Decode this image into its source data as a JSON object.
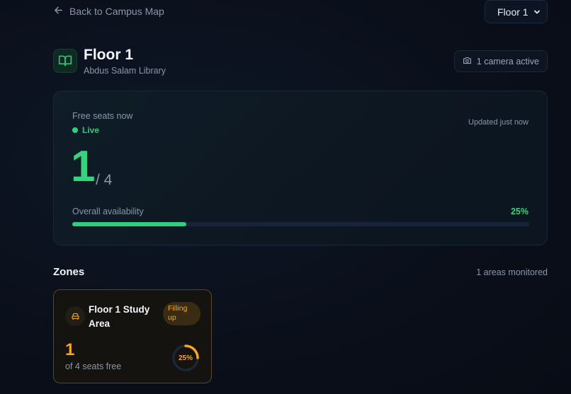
{
  "nav": {
    "back_label": "Back to Campus Map",
    "floor_select_value": "Floor 1"
  },
  "header": {
    "title": "Floor 1",
    "building": "Abdus Salam Library",
    "camera_status": "1 camera active"
  },
  "summary": {
    "free_label": "Free seats now",
    "live_label": "Live",
    "updated_label": "Updated just now",
    "free_seats": "1",
    "total_seats": "/ 4",
    "availability_label": "Overall availability",
    "availability_pct_label": "25%",
    "availability_value": 0.25
  },
  "zones": {
    "title": "Zones",
    "count_label": "1 areas monitored",
    "items": [
      {
        "name": "Floor 1 Study Area",
        "status": "Filling up",
        "free": "1",
        "seats_label": "of 4 seats free",
        "pct_label": "25%",
        "pct_value": 0.25
      }
    ]
  },
  "colors": {
    "accent_green": "#2fcf7d",
    "accent_amber": "#f5a524",
    "background": "#0a0f1a"
  },
  "icons": {
    "back": "arrow-left-icon",
    "select": "chevron-down-icon",
    "floor": "book-open-icon",
    "camera": "camera-icon",
    "zone": "armchair-icon"
  }
}
